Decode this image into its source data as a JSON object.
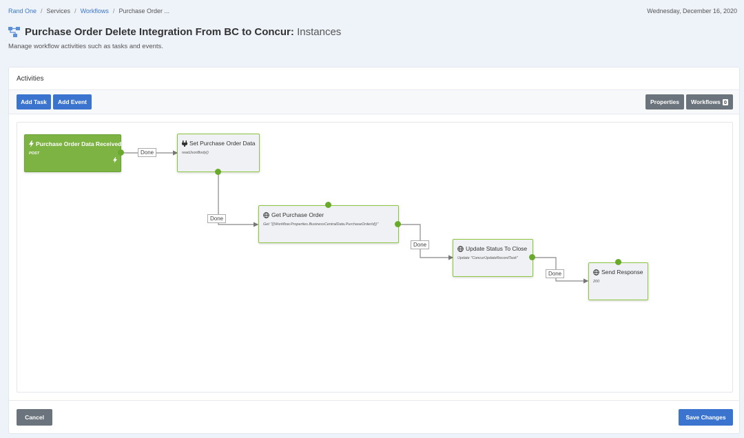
{
  "breadcrumb": {
    "items": [
      "Rand One",
      "Services",
      "Workflows",
      "Purchase Order ..."
    ],
    "separator": "/"
  },
  "date": "Wednesday, December 16, 2020",
  "page": {
    "title": "Purchase Order Delete Integration From BC to Concur:",
    "title_suffix": "Instances",
    "subtitle": "Manage workflow activities such as tasks and events."
  },
  "panel": {
    "header": "Activities",
    "buttons": {
      "add_task": "Add Task",
      "add_event": "Add Event",
      "properties": "Properties",
      "workflows": "Workflows",
      "workflows_count": "0"
    },
    "footer": {
      "cancel": "Cancel",
      "save": "Save Changes"
    }
  },
  "workflow": {
    "nodes": [
      {
        "title": "Purchase Order Data Received",
        "subtitle": "POST",
        "icon": "lightning-icon"
      },
      {
        "title": "Set Purchase Order Data",
        "subtitle": "readJsonBody()",
        "icon": "plug-icon"
      },
      {
        "title": "Get Purchase Order",
        "subtitle": "Get \"{{Workflow.Properties.BusinessCentralData.PurchaseOrderId}}\"",
        "icon": "globe-icon"
      },
      {
        "title": "Update Status To Close",
        "subtitle": "Update \"ConcurUpdateRecordTask\"",
        "icon": "globe-icon"
      },
      {
        "title": "Send Response",
        "subtitle": "200",
        "icon": "globe-icon"
      }
    ],
    "edge_labels": [
      "Done",
      "Done",
      "Done",
      "Done"
    ]
  },
  "colors": {
    "accent_blue": "#3b74cf",
    "node_green": "#7cb342",
    "connector_green": "#6aaa2a",
    "gray_button": "#6b737c"
  }
}
